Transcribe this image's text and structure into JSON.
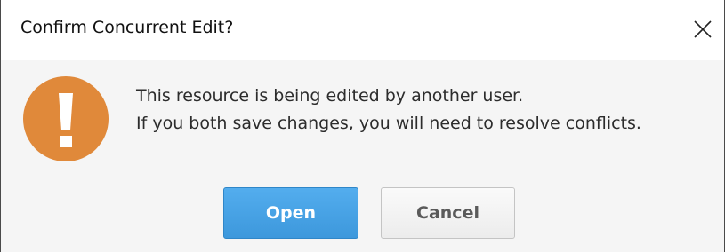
{
  "dialog": {
    "title": "Confirm Concurrent Edit?",
    "close_icon": "close-icon",
    "warning_icon": "warning-exclamation-icon",
    "warning_color": "#e0893a",
    "message_lines": [
      "This resource is being edited by another user.",
      "If you both save changes, you will need to resolve conflicts."
    ],
    "buttons": {
      "open_label": "Open",
      "cancel_label": "Cancel"
    },
    "accent_color": "#4aa6e8"
  }
}
